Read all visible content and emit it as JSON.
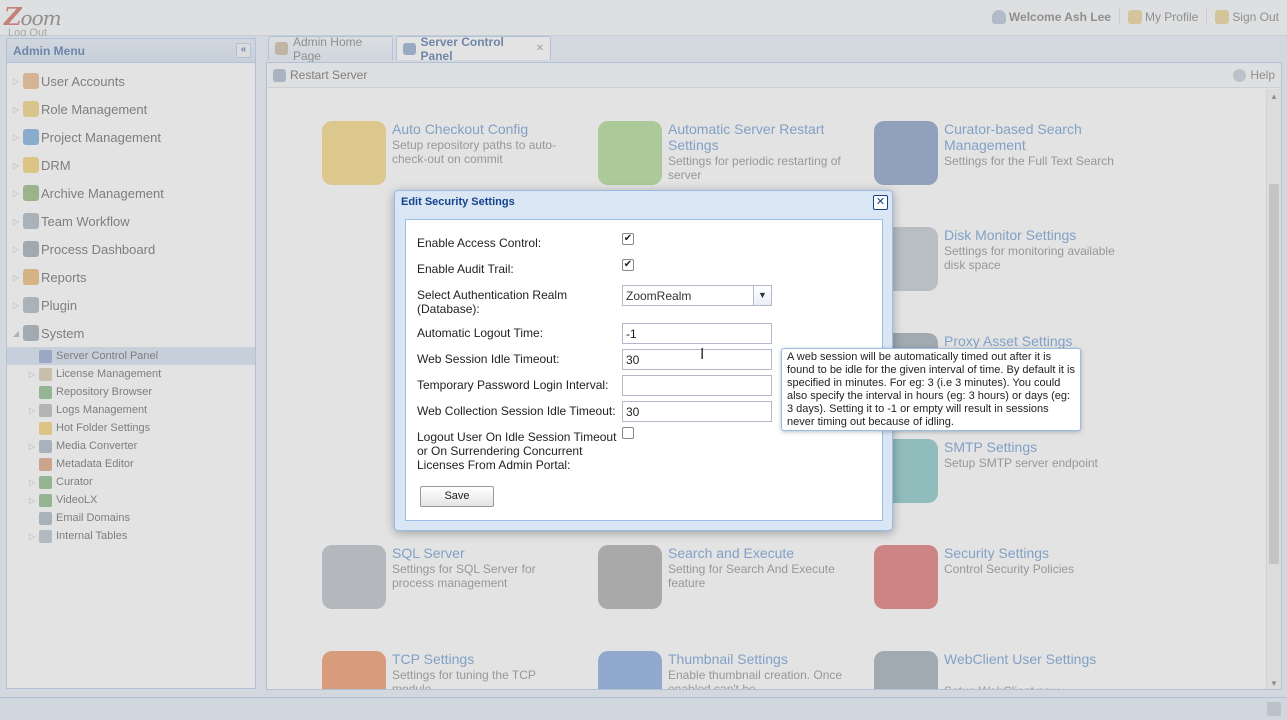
{
  "header": {
    "logo_text": "Zoom",
    "logout_link": "Log Out",
    "welcome": "Welcome Ash Lee",
    "my_profile": "My Profile",
    "sign_out": "Sign Out"
  },
  "sidebar": {
    "title": "Admin Menu",
    "collapse_icon": "«",
    "items": [
      {
        "label": "User Accounts",
        "icon": "users-icon",
        "color": "#e0a060"
      },
      {
        "label": "Role Management",
        "icon": "shield-icon",
        "color": "#e8c050"
      },
      {
        "label": "Project Management",
        "icon": "pie-chart-icon",
        "color": "#4a90d0"
      },
      {
        "label": "DRM",
        "icon": "folder-icon",
        "color": "#f0c040"
      },
      {
        "label": "Archive Management",
        "icon": "archive-icon",
        "color": "#70a050"
      },
      {
        "label": "Team Workflow",
        "icon": "workflow-icon",
        "color": "#8a9aaa"
      },
      {
        "label": "Process Dashboard",
        "icon": "dashboard-icon",
        "color": "#7a8a9a"
      },
      {
        "label": "Reports",
        "icon": "reports-icon",
        "color": "#e0a040"
      },
      {
        "label": "Plugin",
        "icon": "plugin-icon",
        "color": "#8a9aaa"
      },
      {
        "label": "System",
        "icon": "system-icon",
        "color": "#7a8a9a"
      }
    ],
    "system_children": [
      {
        "label": "Server Control Panel",
        "has_arrow": false,
        "color": "#6a8ac0"
      },
      {
        "label": "License Management",
        "has_arrow": true,
        "color": "#c8b890"
      },
      {
        "label": "Repository Browser",
        "has_arrow": false,
        "color": "#60a060"
      },
      {
        "label": "Logs Management",
        "has_arrow": true,
        "color": "#a0a0a0"
      },
      {
        "label": "Hot Folder Settings",
        "has_arrow": false,
        "color": "#f0c040"
      },
      {
        "label": "Media Converter",
        "has_arrow": true,
        "color": "#8a9ab0"
      },
      {
        "label": "Metadata Editor",
        "has_arrow": false,
        "color": "#d08050"
      },
      {
        "label": "Curator",
        "has_arrow": true,
        "color": "#60a060"
      },
      {
        "label": "VideoLX",
        "has_arrow": true,
        "color": "#60a060"
      },
      {
        "label": "Email Domains",
        "has_arrow": false,
        "color": "#8a9aaa"
      },
      {
        "label": "Internal Tables",
        "has_arrow": true,
        "color": "#9aaaba"
      }
    ]
  },
  "tabs": {
    "home": "Admin Home Page",
    "scp": "Server Control Panel",
    "close_icon": "✕"
  },
  "toolbar": {
    "restart": "Restart Server",
    "help": "Help"
  },
  "cards": [
    {
      "title": "Auto Checkout Config",
      "desc": "Setup repository paths to auto-check-out on commit",
      "color": "#f0c850"
    },
    {
      "title": "Automatic Server Restart Settings",
      "desc": "Settings for periodic restarting of server",
      "color": "#8fcb6a"
    },
    {
      "title": "Curator-based Search Management",
      "desc": "Settings for the Full Text Search",
      "color": "#5a7ab0"
    },
    {
      "title": "Disk Monitor Settings",
      "desc": "Settings for monitoring available disk space",
      "color": "#aab4c0"
    },
    {
      "title": "Proxy Asset Settings",
      "desc": "",
      "color": "#7a8a9a"
    },
    {
      "title": "SMTP Settings",
      "desc": "Setup SMTP server endpoint",
      "color": "#5ab0b0"
    },
    {
      "title": "SQL Server",
      "desc": "Settings for SQL Server for process management",
      "color": "#a0a8b0"
    },
    {
      "title": "Search and Execute",
      "desc": "Setting for Search And Execute feature",
      "color": "#8a8a8a"
    },
    {
      "title": "Security Settings",
      "desc": "Control Security Policies",
      "color": "#d04040"
    },
    {
      "title": "TCP Settings",
      "desc": "Settings for tuning the TCP module",
      "color": "#e87030"
    },
    {
      "title": "Thumbnail Settings",
      "desc": "Enable thumbnail creation. Once enabled can't be",
      "color": "#5a8ad0"
    },
    {
      "title": "WebClient User Settings",
      "desc": "Setup WebClient new",
      "color": "#7a8a9a"
    }
  ],
  "dialog": {
    "title": "Edit Security Settings",
    "close_icon": "✕",
    "enable_access_control": "Enable Access Control:",
    "enable_access_control_checked": "✔",
    "enable_audit_trail": "Enable Audit Trail:",
    "enable_audit_trail_checked": "✔",
    "auth_realm_label": "Select Authentication Realm (Database):",
    "auth_realm_value": "ZoomRealm",
    "auto_logout_label": "Automatic Logout Time:",
    "auto_logout_value": "-1",
    "web_session_label": "Web Session Idle Timeout:",
    "web_session_value": "30",
    "temp_password_label": "Temporary Password Login Interval:",
    "temp_password_value": "",
    "web_collection_label": "Web Collection Session Idle Timeout:",
    "web_collection_value": "30",
    "logout_idle_label": "Logout User On Idle Session Timeout or On Surrendering Concurrent Licenses From Admin Portal:",
    "save": "Save"
  },
  "tooltip": {
    "text": "A web session will be automatically timed out after it is found to be idle for the given interval of time. By default it is specified in minutes. For eg: 3 (i.e 3 minutes). You could also specify the interval in hours (eg: 3 hours) or days (eg: 3 days). Setting it to -1 or empty will result in sessions never timing out because of idling."
  }
}
